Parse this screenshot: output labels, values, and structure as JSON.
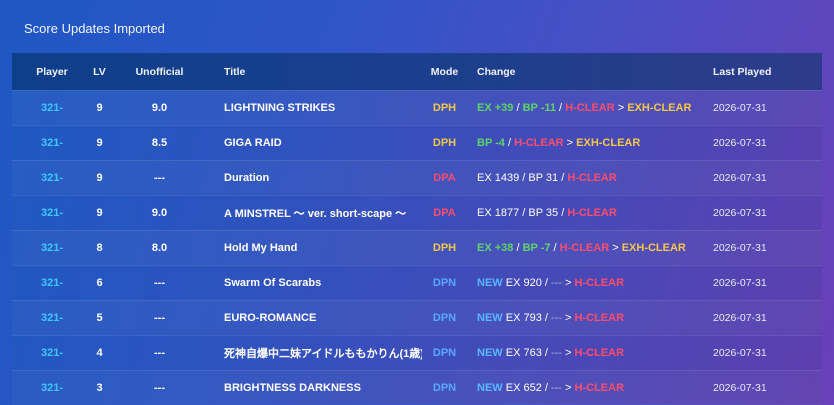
{
  "title": "Score Updates Imported",
  "columns": [
    "Player",
    "LV",
    "Unofficial",
    "Title",
    "Mode",
    "Change",
    "Last Played"
  ],
  "colors": {
    "player": "#3fc7ff",
    "dph": "#f2c84a",
    "dpa": "#ff4d6d",
    "dpn": "#5aa8ff",
    "gain": "#5fd46a",
    "hclear": "#ff4d6d",
    "exhclear": "#f2c84a",
    "new": "#5ab8ff",
    "muted": "#a9b6e0",
    "text": "#ffffff"
  },
  "rows": [
    {
      "player": "321-",
      "lv": "9",
      "unofficial": "9.0",
      "title": "LIGHTNING STRIKES",
      "mode": "DPH",
      "mode_color": "#f2c84a",
      "change": [
        {
          "t": "EX +39",
          "c": "#5fd46a",
          "b": true
        },
        {
          "t": " / ",
          "c": "#ffffff"
        },
        {
          "t": "BP -11",
          "c": "#5fd46a",
          "b": true
        },
        {
          "t": " / ",
          "c": "#ffffff"
        },
        {
          "t": "H-CLEAR",
          "c": "#ff4d6d",
          "b": true
        },
        {
          "t": " > ",
          "c": "#ffffff"
        },
        {
          "t": "EXH-CLEAR",
          "c": "#f2c84a",
          "b": true
        }
      ],
      "last_played": "2026-07-31"
    },
    {
      "player": "321-",
      "lv": "9",
      "unofficial": "8.5",
      "title": "GIGA RAID",
      "mode": "DPH",
      "mode_color": "#f2c84a",
      "change": [
        {
          "t": "BP -4",
          "c": "#5fd46a",
          "b": true
        },
        {
          "t": " / ",
          "c": "#ffffff"
        },
        {
          "t": "H-CLEAR",
          "c": "#ff4d6d",
          "b": true
        },
        {
          "t": " > ",
          "c": "#ffffff"
        },
        {
          "t": "EXH-CLEAR",
          "c": "#f2c84a",
          "b": true
        }
      ],
      "last_played": "2026-07-31"
    },
    {
      "player": "321-",
      "lv": "9",
      "unofficial": "---",
      "title": "Duration",
      "mode": "DPA",
      "mode_color": "#ff4d6d",
      "change": [
        {
          "t": "EX 1439 / BP 31 / ",
          "c": "#ffffff"
        },
        {
          "t": "H-CLEAR",
          "c": "#ff4d6d",
          "b": true
        }
      ],
      "last_played": "2026-07-31"
    },
    {
      "player": "321-",
      "lv": "9",
      "unofficial": "9.0",
      "title": "A MINSTREL 〜 ver. short-scape 〜",
      "mode": "DPA",
      "mode_color": "#ff4d6d",
      "change": [
        {
          "t": "EX 1877 / BP 35 / ",
          "c": "#ffffff"
        },
        {
          "t": "H-CLEAR",
          "c": "#ff4d6d",
          "b": true
        }
      ],
      "last_played": "2026-07-31"
    },
    {
      "player": "321-",
      "lv": "8",
      "unofficial": "8.0",
      "title": "Hold My Hand",
      "mode": "DPH",
      "mode_color": "#f2c84a",
      "change": [
        {
          "t": "EX +38",
          "c": "#5fd46a",
          "b": true
        },
        {
          "t": " / ",
          "c": "#ffffff"
        },
        {
          "t": "BP -7",
          "c": "#5fd46a",
          "b": true
        },
        {
          "t": " / ",
          "c": "#ffffff"
        },
        {
          "t": "H-CLEAR",
          "c": "#ff4d6d",
          "b": true
        },
        {
          "t": " > ",
          "c": "#ffffff"
        },
        {
          "t": "EXH-CLEAR",
          "c": "#f2c84a",
          "b": true
        }
      ],
      "last_played": "2026-07-31"
    },
    {
      "player": "321-",
      "lv": "6",
      "unofficial": "---",
      "title": "Swarm Of Scarabs",
      "mode": "DPN",
      "mode_color": "#5aa8ff",
      "change": [
        {
          "t": "NEW",
          "c": "#5ab8ff",
          "b": true
        },
        {
          "t": " EX 920 / ",
          "c": "#ffffff"
        },
        {
          "t": "---",
          "c": "#a9b6e0"
        },
        {
          "t": " > ",
          "c": "#ffffff"
        },
        {
          "t": "H-CLEAR",
          "c": "#ff4d6d",
          "b": true
        }
      ],
      "last_played": "2026-07-31"
    },
    {
      "player": "321-",
      "lv": "5",
      "unofficial": "---",
      "title": "EURO-ROMANCE",
      "mode": "DPN",
      "mode_color": "#5aa8ff",
      "change": [
        {
          "t": "NEW",
          "c": "#5ab8ff",
          "b": true
        },
        {
          "t": " EX 793 / ",
          "c": "#ffffff"
        },
        {
          "t": "---",
          "c": "#a9b6e0"
        },
        {
          "t": " > ",
          "c": "#ffffff"
        },
        {
          "t": "H-CLEAR",
          "c": "#ff4d6d",
          "b": true
        }
      ],
      "last_played": "2026-07-31"
    },
    {
      "player": "321-",
      "lv": "4",
      "unofficial": "---",
      "title": "死神自爆中二妹アイドルももかりん(1歳)",
      "mode": "DPN",
      "mode_color": "#5aa8ff",
      "change": [
        {
          "t": "NEW",
          "c": "#5ab8ff",
          "b": true
        },
        {
          "t": " EX 763 / ",
          "c": "#ffffff"
        },
        {
          "t": "---",
          "c": "#a9b6e0"
        },
        {
          "t": " > ",
          "c": "#ffffff"
        },
        {
          "t": "H-CLEAR",
          "c": "#ff4d6d",
          "b": true
        }
      ],
      "last_played": "2026-07-31"
    },
    {
      "player": "321-",
      "lv": "3",
      "unofficial": "---",
      "title": "BRIGHTNESS DARKNESS",
      "mode": "DPN",
      "mode_color": "#5aa8ff",
      "change": [
        {
          "t": "NEW",
          "c": "#5ab8ff",
          "b": true
        },
        {
          "t": " EX 652 / ",
          "c": "#ffffff"
        },
        {
          "t": "---",
          "c": "#a9b6e0"
        },
        {
          "t": " > ",
          "c": "#ffffff"
        },
        {
          "t": "H-CLEAR",
          "c": "#ff4d6d",
          "b": true
        }
      ],
      "last_played": "2026-07-31"
    }
  ]
}
